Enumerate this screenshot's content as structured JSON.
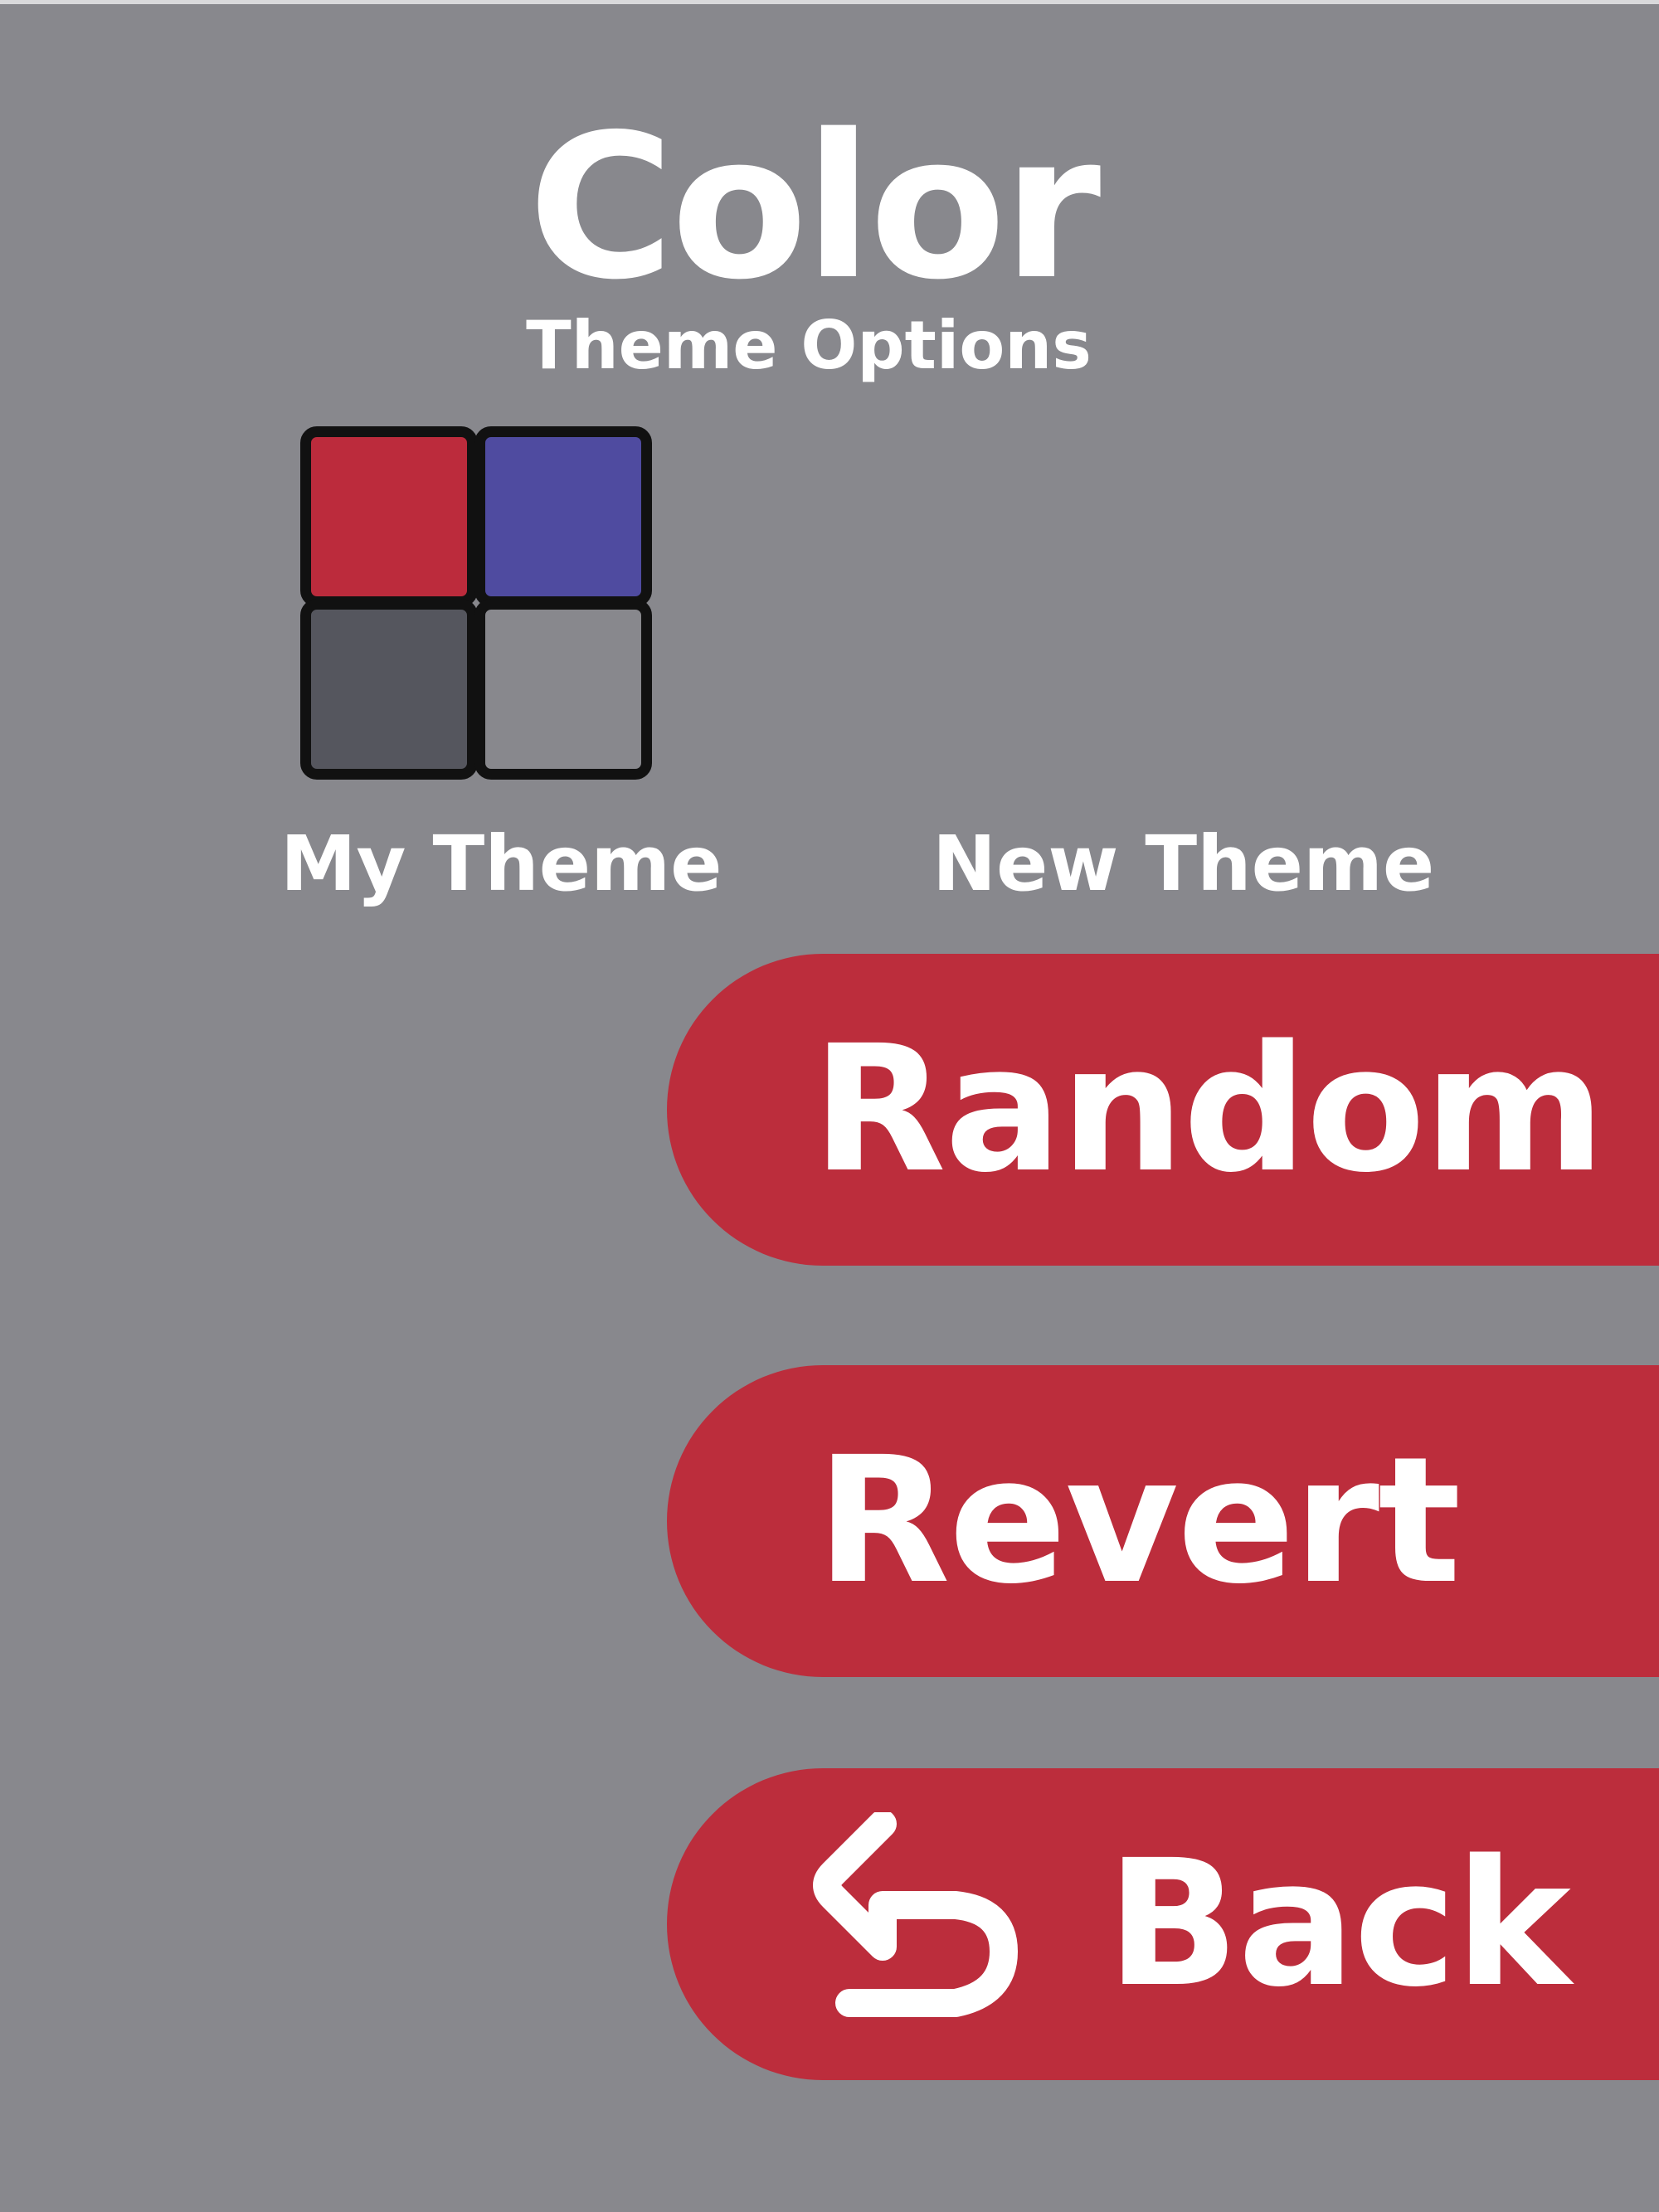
{
  "header": {
    "title": "Color",
    "subtitle": "Theme Options"
  },
  "themes": {
    "my_theme_label": "My Theme",
    "new_theme_label": "New Theme",
    "my_theme_swatches": [
      "#bc2b3c",
      "#4f4ba0",
      "#55565e",
      "#88888d"
    ]
  },
  "buttons": {
    "random_label": "Random",
    "revert_label": "Revert",
    "back_label": "Back",
    "back_icon": "return-arrow-icon"
  },
  "colors": {
    "background": "#88888d",
    "accent": "#bc2d3c",
    "text": "#ffffff",
    "swatch_border": "#111111"
  }
}
